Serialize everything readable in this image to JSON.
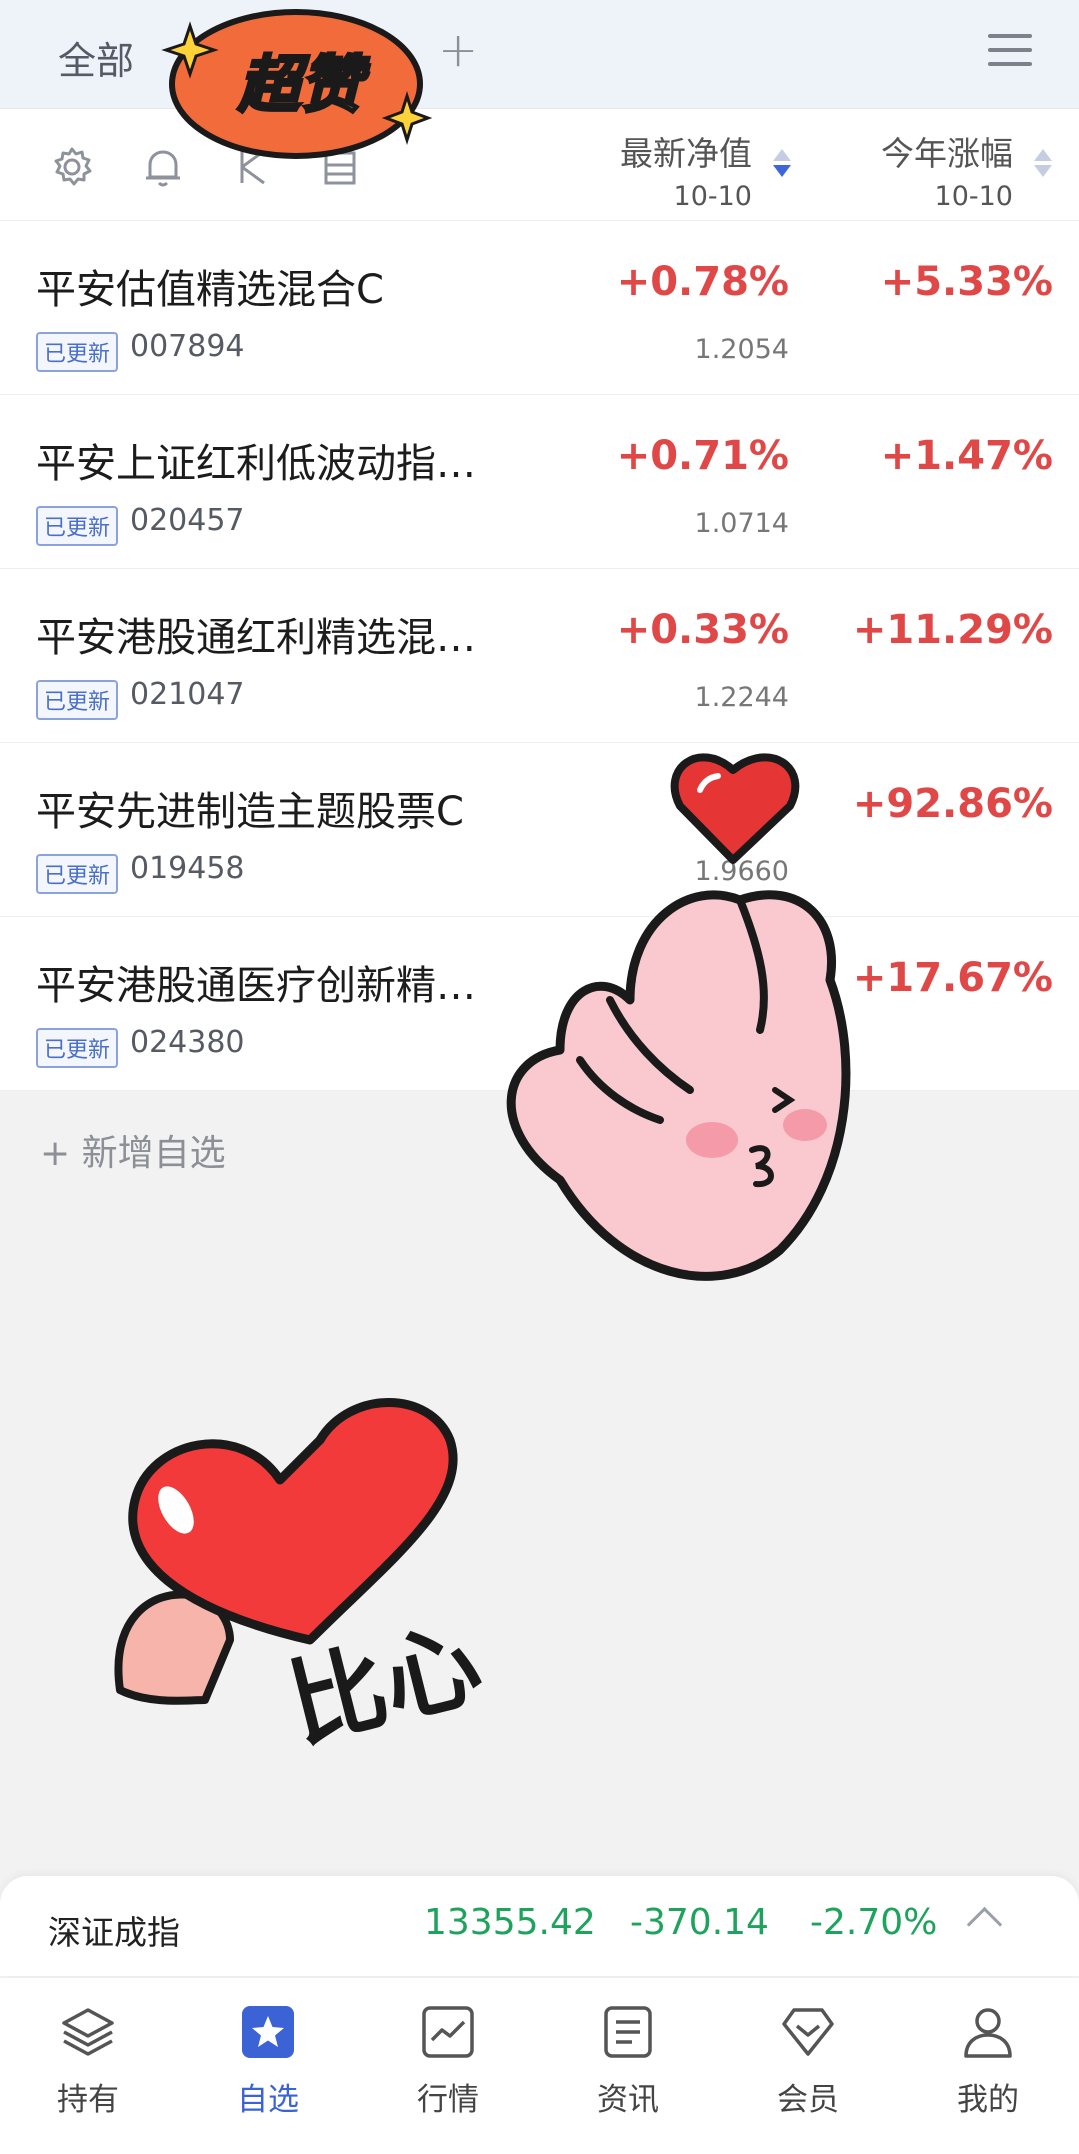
{
  "top": {
    "tab_all": "全部",
    "add_tab": "+"
  },
  "columns": {
    "nav": {
      "label": "最新净值",
      "date": "10-10"
    },
    "ytd": {
      "label": "今年涨幅",
      "date": "10-10"
    }
  },
  "funds": [
    {
      "name": "平安估值精选混合C",
      "badge": "已更新",
      "code": "007894",
      "change": "+0.78%",
      "nav": "1.2054",
      "ytd": "+5.33%"
    },
    {
      "name": "平安上证红利低波动指…",
      "badge": "已更新",
      "code": "020457",
      "change": "+0.71%",
      "nav": "1.0714",
      "ytd": "+1.47%"
    },
    {
      "name": "平安港股通红利精选混…",
      "badge": "已更新",
      "code": "021047",
      "change": "+0.33%",
      "nav": "1.2244",
      "ytd": "+11.29%"
    },
    {
      "name": "平安先进制造主题股票C",
      "badge": "已更新",
      "code": "019458",
      "change": "",
      "nav": "1.9660",
      "ytd": "+92.86%"
    },
    {
      "name": "平安港股通医疗创新精…",
      "badge": "已更新",
      "code": "024380",
      "change": "",
      "nav": "",
      "ytd": "+17.67%"
    }
  ],
  "add_watch": "+ 新增自选",
  "stickers": {
    "super_like": "超赞",
    "bixin": "比心"
  },
  "index": {
    "name": "深证成指",
    "value": "13355.42",
    "change": "-370.14",
    "change_pct": "-2.70%"
  },
  "bottom_nav": [
    {
      "label": "持有",
      "icon": "layers-icon"
    },
    {
      "label": "自选",
      "icon": "star-icon"
    },
    {
      "label": "行情",
      "icon": "chart-icon"
    },
    {
      "label": "资讯",
      "icon": "document-icon"
    },
    {
      "label": "会员",
      "icon": "diamond-icon"
    },
    {
      "label": "我的",
      "icon": "user-icon"
    }
  ],
  "colors": {
    "up": "#e04848",
    "down": "#1ea35c",
    "accent": "#3b63d6"
  }
}
